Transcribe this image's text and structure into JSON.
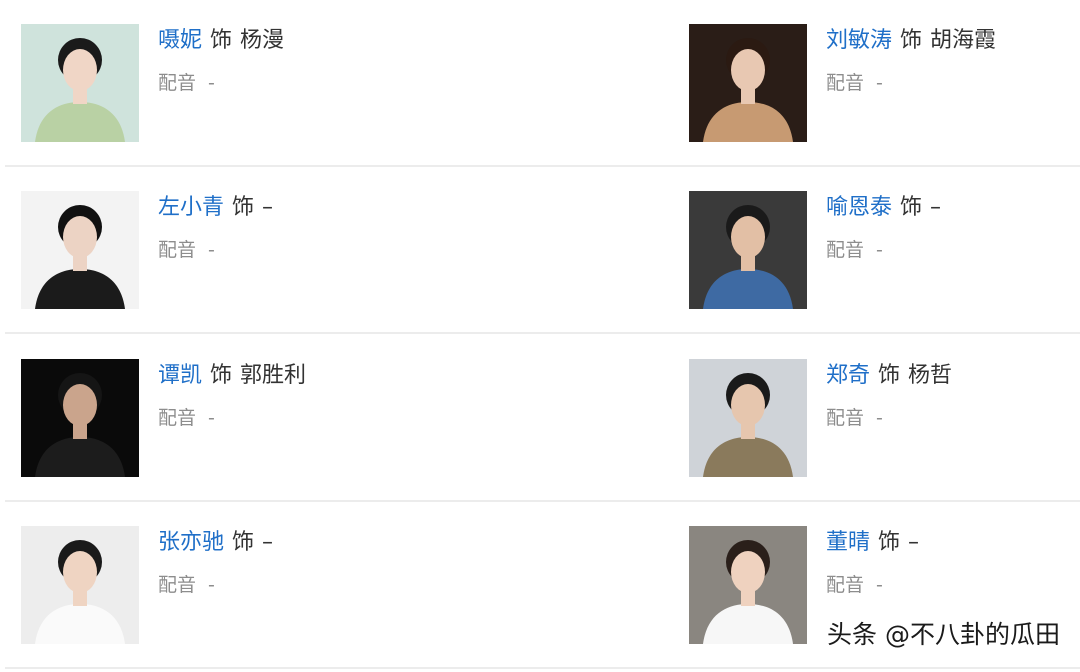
{
  "cast": [
    {
      "actor": "嗫妮",
      "plays": "饰",
      "role": "杨漫",
      "dub_label": "配音",
      "dub_value": "-",
      "colors": {
        "bg": "#cfe3dc",
        "hair": "#1a1a1a",
        "skin": "#f0d6c6",
        "cloth": "#b9d1a4"
      }
    },
    {
      "actor": "刘敏涛",
      "plays": "饰",
      "role": "胡海霞",
      "dub_label": "配音",
      "dub_value": "-",
      "colors": {
        "bg": "#2a1d17",
        "hair": "#2b1a12",
        "skin": "#e8c8b2",
        "cloth": "#c79a72"
      }
    },
    {
      "actor": "左小青",
      "plays": "饰",
      "role": "–",
      "dub_label": "配音",
      "dub_value": "-",
      "colors": {
        "bg": "#f3f3f3",
        "hair": "#111111",
        "skin": "#ecd3c4",
        "cloth": "#1b1b1b"
      }
    },
    {
      "actor": "喻恩泰",
      "plays": "饰",
      "role": "–",
      "dub_label": "配音",
      "dub_value": "-",
      "colors": {
        "bg": "#3a3a3a",
        "hair": "#1a1a1a",
        "skin": "#e2bfa5",
        "cloth": "#3e6aa3"
      }
    },
    {
      "actor": "谭凯",
      "plays": "饰",
      "role": "郭胜利",
      "dub_label": "配音",
      "dub_value": "-",
      "colors": {
        "bg": "#0a0a0a",
        "hair": "#151515",
        "skin": "#caa48c",
        "cloth": "#1c1c1c"
      }
    },
    {
      "actor": "郑奇",
      "plays": "饰",
      "role": "杨哲",
      "dub_label": "配音",
      "dub_value": "-",
      "colors": {
        "bg": "#cfd3d8",
        "hair": "#1a1a1a",
        "skin": "#e6c6ae",
        "cloth": "#8a7a5c"
      }
    },
    {
      "actor": "张亦驰",
      "plays": "饰",
      "role": "–",
      "dub_label": "配音",
      "dub_value": "-",
      "colors": {
        "bg": "#ededed",
        "hair": "#1a1a1a",
        "skin": "#efd4c2",
        "cloth": "#fafafa"
      }
    },
    {
      "actor": "董晴",
      "plays": "饰",
      "role": "–",
      "dub_label": "配音",
      "dub_value": "-",
      "colors": {
        "bg": "#8a8680",
        "hair": "#2a1f1a",
        "skin": "#efd2bf",
        "cloth": "#f7f7f7"
      }
    }
  ],
  "watermark": "头条 @不八卦的瓜田",
  "colors": {
    "link": "#1f6fc8",
    "text": "#333333",
    "muted": "#8d8d8d",
    "divider": "#ececec"
  }
}
